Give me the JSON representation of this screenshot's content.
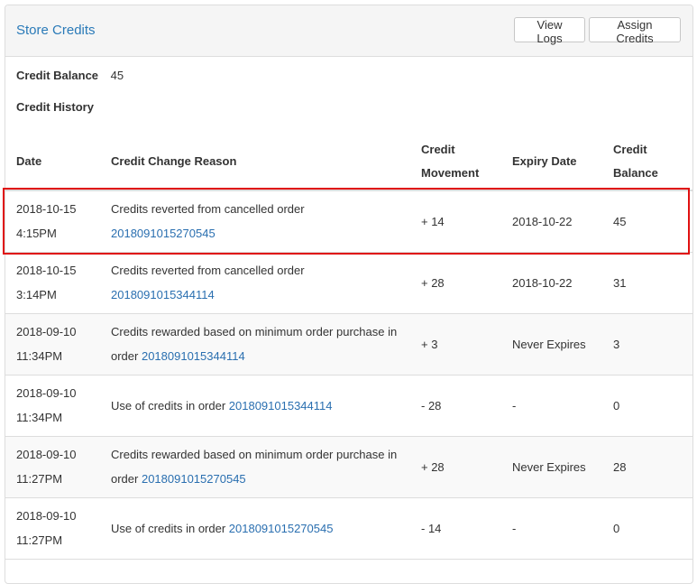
{
  "header": {
    "title": "Store Credits",
    "view_logs_label": "View Logs",
    "assign_credits_label": "Assign Credits"
  },
  "summary": {
    "balance_label": "Credit Balance",
    "balance_value": "45",
    "history_label": "Credit History"
  },
  "table": {
    "columns": {
      "date": "Date",
      "reason": "Credit Change Reason",
      "movement": "Credit Movement",
      "expiry": "Expiry Date",
      "balance": "Credit Balance"
    },
    "rows": [
      {
        "date": "2018-10-15 4:15PM",
        "reason": "Credits reverted from cancelled order ",
        "order": "2018091015270545",
        "movement": "+ 14",
        "expiry": "2018-10-22",
        "balance": "45"
      },
      {
        "date": "2018-10-15 3:14PM",
        "reason": "Credits reverted from cancelled order ",
        "order": "2018091015344114",
        "movement": "+ 28",
        "expiry": "2018-10-22",
        "balance": "31"
      },
      {
        "date": "2018-09-10 11:34PM",
        "reason": "Credits rewarded based on minimum order purchase in order ",
        "order": "2018091015344114",
        "movement": "+ 3",
        "expiry": "Never Expires",
        "balance": "3"
      },
      {
        "date": "2018-09-10 11:34PM",
        "reason": "Use of credits in order ",
        "order": "2018091015344114",
        "movement": "- 28",
        "expiry": "-",
        "balance": "0"
      },
      {
        "date": "2018-09-10 11:27PM",
        "reason": "Credits rewarded based on minimum order purchase in order ",
        "order": "2018091015270545",
        "movement": "+ 28",
        "expiry": "Never Expires",
        "balance": "28"
      },
      {
        "date": "2018-09-10 11:27PM",
        "reason": "Use of credits in order ",
        "order": "2018091015270545",
        "movement": "- 14",
        "expiry": "-",
        "balance": "0"
      }
    ]
  },
  "colors": {
    "link": "#2a6fb0",
    "title": "#2a7ab8",
    "highlight": "#e01010",
    "border": "#dddddd",
    "row_alt": "#f9f9f9"
  }
}
